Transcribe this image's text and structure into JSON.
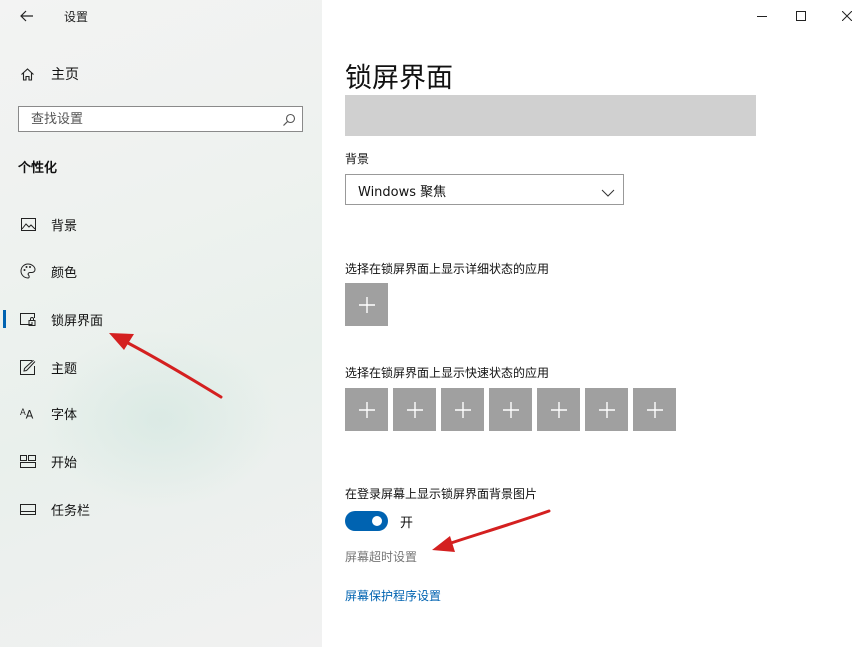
{
  "window": {
    "title": "设置",
    "controls": [
      "minimize-icon",
      "maximize-icon",
      "close-icon"
    ]
  },
  "sidebar": {
    "home_label": "主页",
    "search": {
      "placeholder": "查找设置",
      "value": ""
    },
    "section_heading": "个性化",
    "items": [
      {
        "label": "背景",
        "icon": "image-icon",
        "selected": false
      },
      {
        "label": "颜色",
        "icon": "palette-icon",
        "selected": false
      },
      {
        "label": "锁屏界面",
        "icon": "lock-screen-icon",
        "selected": true
      },
      {
        "label": "主题",
        "icon": "theme-brush-icon",
        "selected": false
      },
      {
        "label": "字体",
        "icon": "font-icon",
        "selected": false
      },
      {
        "label": "开始",
        "icon": "start-menu-icon",
        "selected": false
      },
      {
        "label": "任务栏",
        "icon": "taskbar-icon",
        "selected": false
      }
    ]
  },
  "main": {
    "title": "锁屏界面",
    "background_label": "背景",
    "background_value": "Windows 聚焦",
    "detailed_status_label": "选择在锁屏界面上显示详细状态的应用",
    "detailed_status_slots": 1,
    "quick_status_label": "选择在锁屏界面上显示快速状态的应用",
    "quick_status_slots": 7,
    "signin_bg_label": "在登录屏幕上显示锁屏界面背景图片",
    "signin_bg_state": "开",
    "signin_bg_on": true,
    "screen_timeout_link": "屏幕超时设置",
    "screensaver_link": "屏幕保护程序设置"
  },
  "colors": {
    "accent": "#0063b1",
    "tile": "#a0a0a0",
    "annotation_arrow": "#d42020"
  }
}
